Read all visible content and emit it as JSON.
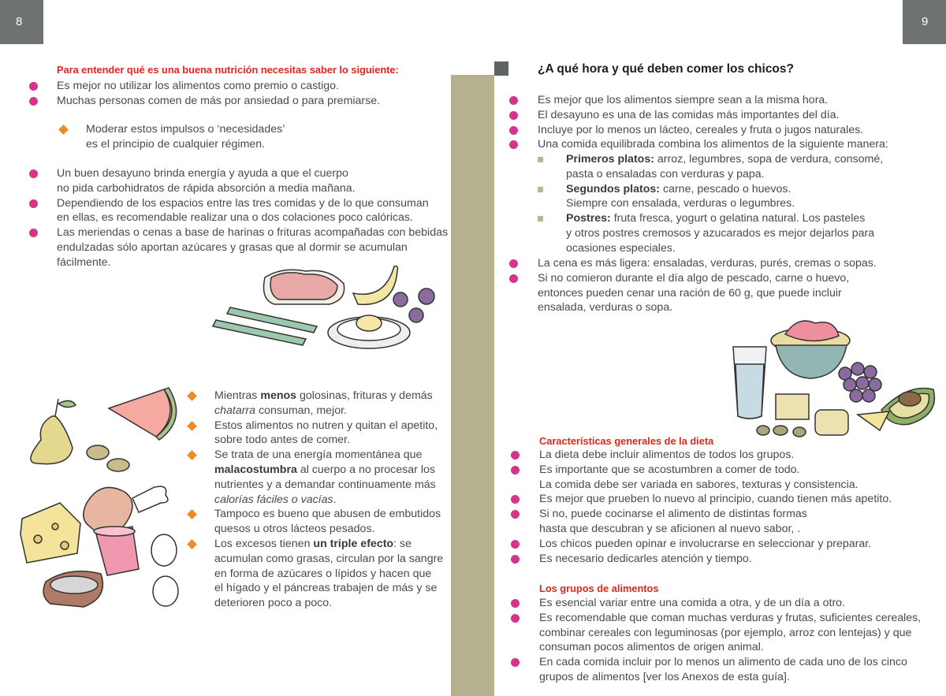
{
  "page_numbers": {
    "left": "8",
    "right": "9"
  },
  "left": {
    "intro_heading": "Para entender qué es una buena nutrición necesitas saber lo siguiente:",
    "bullets_1": [
      "Es mejor no utilizar los alimentos como premio o castigo.",
      "Muchas personas comen de más por ansiedad o para premiarse."
    ],
    "diamond_1": [
      "Moderar estos impulsos o ‘necesidades’",
      "es el principio de cualquier régimen."
    ],
    "bullets_2": [
      [
        "Un buen desayuno brinda energía y ayuda a que el cuerpo",
        "no pida carbohidratos de rápida absorción a media mañana."
      ],
      [
        "Dependiendo de los espacios entre las tres comidas y de lo que consuman",
        "en ellas, es recomendable realizar una o dos colaciones poco calóricas."
      ],
      [
        "Las meriendas o cenas a base de harinas o frituras acompañadas con bebidas",
        "endulzadas sólo aportan azúcares y grasas que al dormir se acumulan",
        "fácilmente."
      ]
    ],
    "tips": {
      "t1_a": "Mientras ",
      "t1_b": "menos",
      "t1_c": " golosinas, frituras y demás",
      "t1_d": "chatarra",
      "t1_e": " consuman, mejor.",
      "t2": [
        "Estos alimentos no nutren y quitan el apetito,",
        "sobre todo antes de comer."
      ],
      "t3_a": "Se trata de una energía momentánea que",
      "t3_b": "malacostumbra",
      "t3_c": " al cuerpo a no procesar los",
      "t3_d": "nutrientes y a demandar continuamente más",
      "t3_e": "calorías fáciles o vacías",
      "t3_f": ".",
      "t4": [
        "Tampoco es bueno que abusen de embutidos",
        "quesos u otros lácteos pesados."
      ],
      "t5_a": "Los excesos tienen ",
      "t5_b": "un triple efecto",
      "t5_c": ": se",
      "t5_rest": [
        "acumulan como grasas, circulan por la sangre",
        "en forma de azúcares o lípidos y hacen que",
        "el hígado y el páncreas trabajen de más y se",
        "deterioren poco a poco."
      ]
    }
  },
  "right": {
    "title": "¿A qué hora y qué deben comer los chicos?",
    "bullets_1": [
      "Es mejor que los alimentos siempre sean a la misma hora.",
      "El desayuno es una de las comidas más importantes del día.",
      "Incluye por lo menos un lácteo, cereales y fruta o jugos naturales.",
      "Una comida equilibrada combina los alimentos de la siguiente manera:"
    ],
    "meals": {
      "m1_label": "Primeros platos:",
      "m1_text": " arroz, legumbres, sopa de verdura, consomé,",
      "m1_cont": "pasta o ensaladas con verduras y papa.",
      "m2_label": "Segundos platos:",
      "m2_text": " carne, pescado o huevos.",
      "m2_cont": "Siempre con ensalada, verduras o legumbres.",
      "m3_label": "Postres:",
      "m3_text": " fruta fresca, yogurt o gelatina natural. Los pasteles",
      "m3_cont": [
        "y otros postres cremosos y azucarados es mejor dejarlos para",
        "ocasiones especiales."
      ]
    },
    "bullets_2": [
      [
        "La cena es más ligera: ensaladas, verduras, purés, cremas o sopas."
      ],
      [
        "Si no comieron durante el día algo de pescado, carne o huevo,",
        "entonces pueden cenar una ración de 60 g, que puede incluir",
        "ensalada, verduras o sopa."
      ]
    ],
    "diet_heading": "Características generales de la dieta",
    "diet_bullets": [
      [
        "La dieta debe incluir alimentos de todos los grupos."
      ],
      [
        "Es importante que se acostumbren a comer de todo.",
        "La comida debe ser variada en sabores, texturas y consistencia."
      ],
      [
        "Es mejor que prueben lo nuevo al principio, cuando tienen más apetito."
      ],
      [
        "Si no, puede cocinarse el alimento de distintas formas",
        "hasta que descubran y se aficionen al nuevo sabor, ."
      ],
      [
        "Los chicos pueden opinar e involucrarse en seleccionar y preparar."
      ],
      [
        "Es necesario dedicarles atención y tiempo."
      ]
    ],
    "groups_heading": "Los grupos de alimentos",
    "groups_bullets": [
      [
        "Es esencial variar entre una comida a otra, y de un día a otro."
      ],
      [
        "Es recomendable que coman muchas verduras y frutas, suficientes cereales,",
        "combinar cereales con leguminosas (por ejemplo, arroz con lentejas) y que",
        "consuman pocos alimentos de origen animal."
      ],
      [
        "En cada comida incluir por lo menos un alimento de cada uno de los cinco",
        "grupos de alimentos [ver los Anexos de esta guía]."
      ]
    ]
  },
  "colors": {
    "bullet": "#d6338a",
    "diamond": "#ef8a26",
    "heading_red": "#e2261d",
    "spine": "#b5b08d",
    "page_tab": "#6e7271"
  }
}
